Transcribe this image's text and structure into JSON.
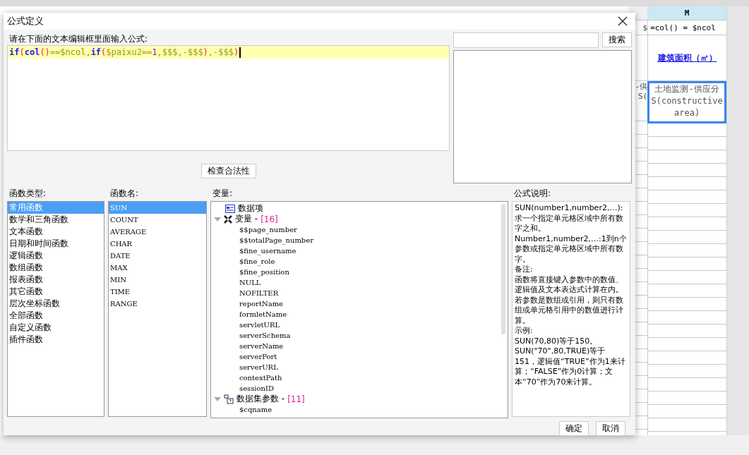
{
  "sheet": {
    "column_header": "M",
    "strip_cells": [
      "$",
      "-供",
      "S("
    ],
    "cells": [
      {
        "kind": "formula",
        "text": "=col() = $ncol"
      },
      {
        "kind": "heading",
        "text": "建筑面积（㎡）"
      },
      {
        "kind": "selected",
        "lines": [
          "土地监测-供应分",
          "S(constructive",
          "area)"
        ]
      }
    ]
  },
  "dialog": {
    "title": "公式定义",
    "editor_label": "请在下面的文本编辑框里面输入公式:",
    "formula": [
      {
        "kind": "keyword",
        "text": "if"
      },
      {
        "kind": "paren",
        "text": "("
      },
      {
        "kind": "keyword",
        "text": "col"
      },
      {
        "kind": "paren",
        "text": "()"
      },
      {
        "kind": "operator",
        "text": "==$ncol,"
      },
      {
        "kind": "keyword",
        "text": "if"
      },
      {
        "kind": "paren",
        "text": "("
      },
      {
        "kind": "operator",
        "text": "$paixu2=="
      },
      {
        "kind": "number",
        "text": "1"
      },
      {
        "kind": "operator",
        "text": ",$$$,-$$$"
      },
      {
        "kind": "paren",
        "text": ")"
      },
      {
        "kind": "operator",
        "text": ",-$$$"
      },
      {
        "kind": "paren",
        "text": ")"
      }
    ],
    "search_button": "搜索",
    "check_button": "检查合法性",
    "function_types_label": "函数类型:",
    "function_types": [
      {
        "label": "常用函数",
        "selected": true
      },
      {
        "label": "数学和三角函数",
        "selected": false
      },
      {
        "label": "文本函数",
        "selected": false
      },
      {
        "label": "日期和时间函数",
        "selected": false
      },
      {
        "label": "逻辑函数",
        "selected": false
      },
      {
        "label": "数组函数",
        "selected": false
      },
      {
        "label": "报表函数",
        "selected": false
      },
      {
        "label": "其它函数",
        "selected": false
      },
      {
        "label": "层次坐标函数",
        "selected": false
      },
      {
        "label": "全部函数",
        "selected": false
      },
      {
        "label": "自定义函数",
        "selected": false
      },
      {
        "label": "插件函数",
        "selected": false
      }
    ],
    "function_names_label": "函数名:",
    "function_names": [
      {
        "label": "SUN",
        "selected": true
      },
      {
        "label": "COUNT",
        "selected": false
      },
      {
        "label": "AVERAGE",
        "selected": false
      },
      {
        "label": "CHAR",
        "selected": false
      },
      {
        "label": "DATE",
        "selected": false
      },
      {
        "label": "MAX",
        "selected": false
      },
      {
        "label": "MIN",
        "selected": false
      },
      {
        "label": "TIME",
        "selected": false
      },
      {
        "label": "RANGE",
        "selected": false
      }
    ],
    "variables_label": "变量:",
    "variables": [
      {
        "kind": "data",
        "label": "数据项"
      },
      {
        "kind": "vars",
        "label": "变量 - ",
        "count": "[16]",
        "expanded": true,
        "children": [
          {
            "label": "$$page_number"
          },
          {
            "label": "$$totalPage_number"
          },
          {
            "label": "$fine_username"
          },
          {
            "label": "$fine_role"
          },
          {
            "label": "$fine_position"
          },
          {
            "label": "NULL"
          },
          {
            "label": "NOFILTER"
          },
          {
            "label": "reportName"
          },
          {
            "label": "formletName"
          },
          {
            "label": "servletURL"
          },
          {
            "label": "serverSchema"
          },
          {
            "label": "serverName"
          },
          {
            "label": "serverPort"
          },
          {
            "label": "serverURL"
          },
          {
            "label": "contextPath"
          },
          {
            "label": "sessionID"
          }
        ]
      },
      {
        "kind": "params",
        "label": "数据集参数 - ",
        "count": "[11]",
        "expanded": true,
        "children": [
          {
            "label": "$cqname"
          }
        ]
      }
    ],
    "description_label": "公式说明:",
    "description": [
      "SUN(number1,number2,…):求一个指定单元格区域中所有数字之和。",
      "Number1,number2,…:1到n个参数或指定单元格区域中所有数字。",
      "备注:",
      "函数将直接键入参数中的数值、逻辑值及文本表达式计算在内。若参数是数组或引用，则只有数组或单元格引用中的数值进行计算。",
      "示例:",
      "SUN(70,80)等于150。",
      "SUN(\"70\",80,TRUE)等于151，逻辑值“TRUE”作为1来计算；“FALSE”作为0计算；文本“70”作为70来计算。"
    ],
    "ok_button": "确定",
    "cancel_button": "取消"
  }
}
